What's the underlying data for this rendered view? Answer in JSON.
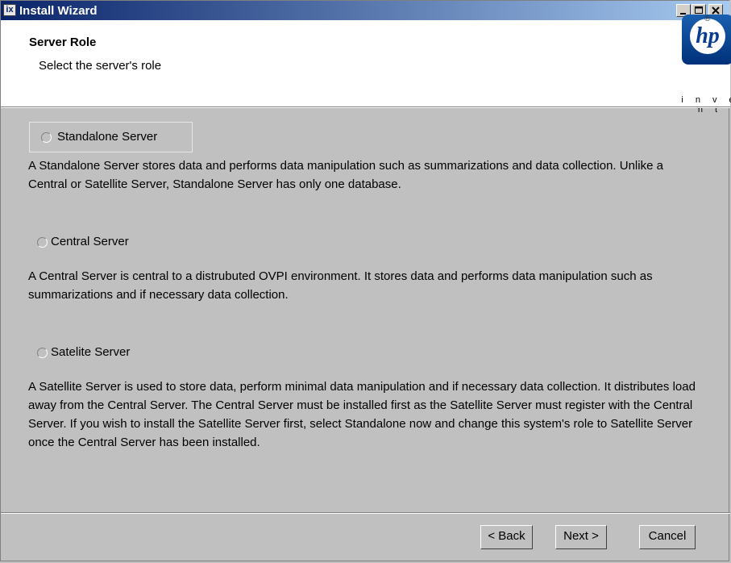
{
  "window": {
    "title": "Install Wizard",
    "icon": "installer-app-icon"
  },
  "header": {
    "title": "Server Role",
    "subtitle": "Select the server's role",
    "logo": {
      "mark": "hp",
      "tagline": "i n v e n t",
      "registered": "®"
    }
  },
  "options": [
    {
      "label": "Standalone Server",
      "description": "A Standalone Server stores data and performs data manipulation such as summarizations and data collection. Unlike a Central or Satellite Server, Standalone Server has only one database."
    },
    {
      "label": "Central Server",
      "description": "A Central Server is central to a distrubuted OVPI environment. It stores data and performs data manipulation such as summarizations and if necessary data collection."
    },
    {
      "label": "Satelite Server",
      "description": "A Satellite Server is used to store data, perform minimal data manipulation and if necessary data collection. It distributes load away from the Central Server. The Central Server must be installed first as the Satellite Server must register with the Central Server. If you wish to install the Satellite Server first, select Standalone now and change this system's role to Satellite Server once the Central Server has been installed."
    }
  ],
  "buttons": {
    "back": "< Back",
    "next": "Next >",
    "cancel": "Cancel"
  },
  "colors": {
    "titlebar_start": "#0a246a",
    "titlebar_end": "#a6caf0",
    "panel": "#c0c0c0",
    "logo_blue": "#0a3d91"
  }
}
